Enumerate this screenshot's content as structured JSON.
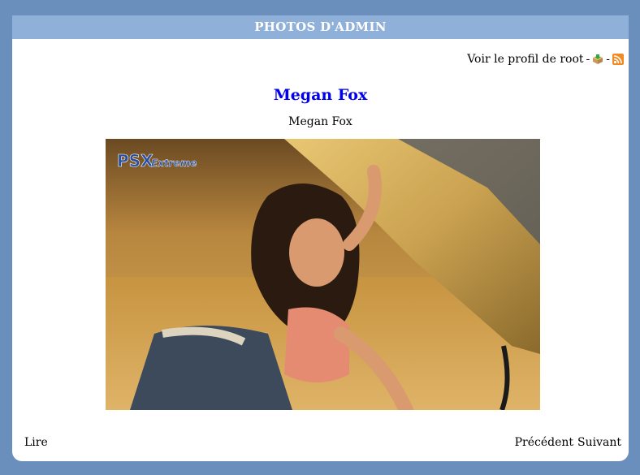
{
  "header": {
    "title": "PHOTOS D'ADMIN"
  },
  "profile": {
    "link_text": "Voir le profil de root",
    "separator_1": "-",
    "separator_2": "-"
  },
  "photo": {
    "title": "Megan Fox",
    "caption": "Megan Fox",
    "watermark": "PSX Extreme"
  },
  "footer": {
    "read_label": "Lire",
    "previous_label": "Précédent",
    "next_label": "Suivant"
  },
  "colors": {
    "background": "#6b8fbd",
    "header_bg": "#8fb0d8",
    "title_link": "#0000ee"
  },
  "icons": [
    "package-icon",
    "rss-icon"
  ]
}
